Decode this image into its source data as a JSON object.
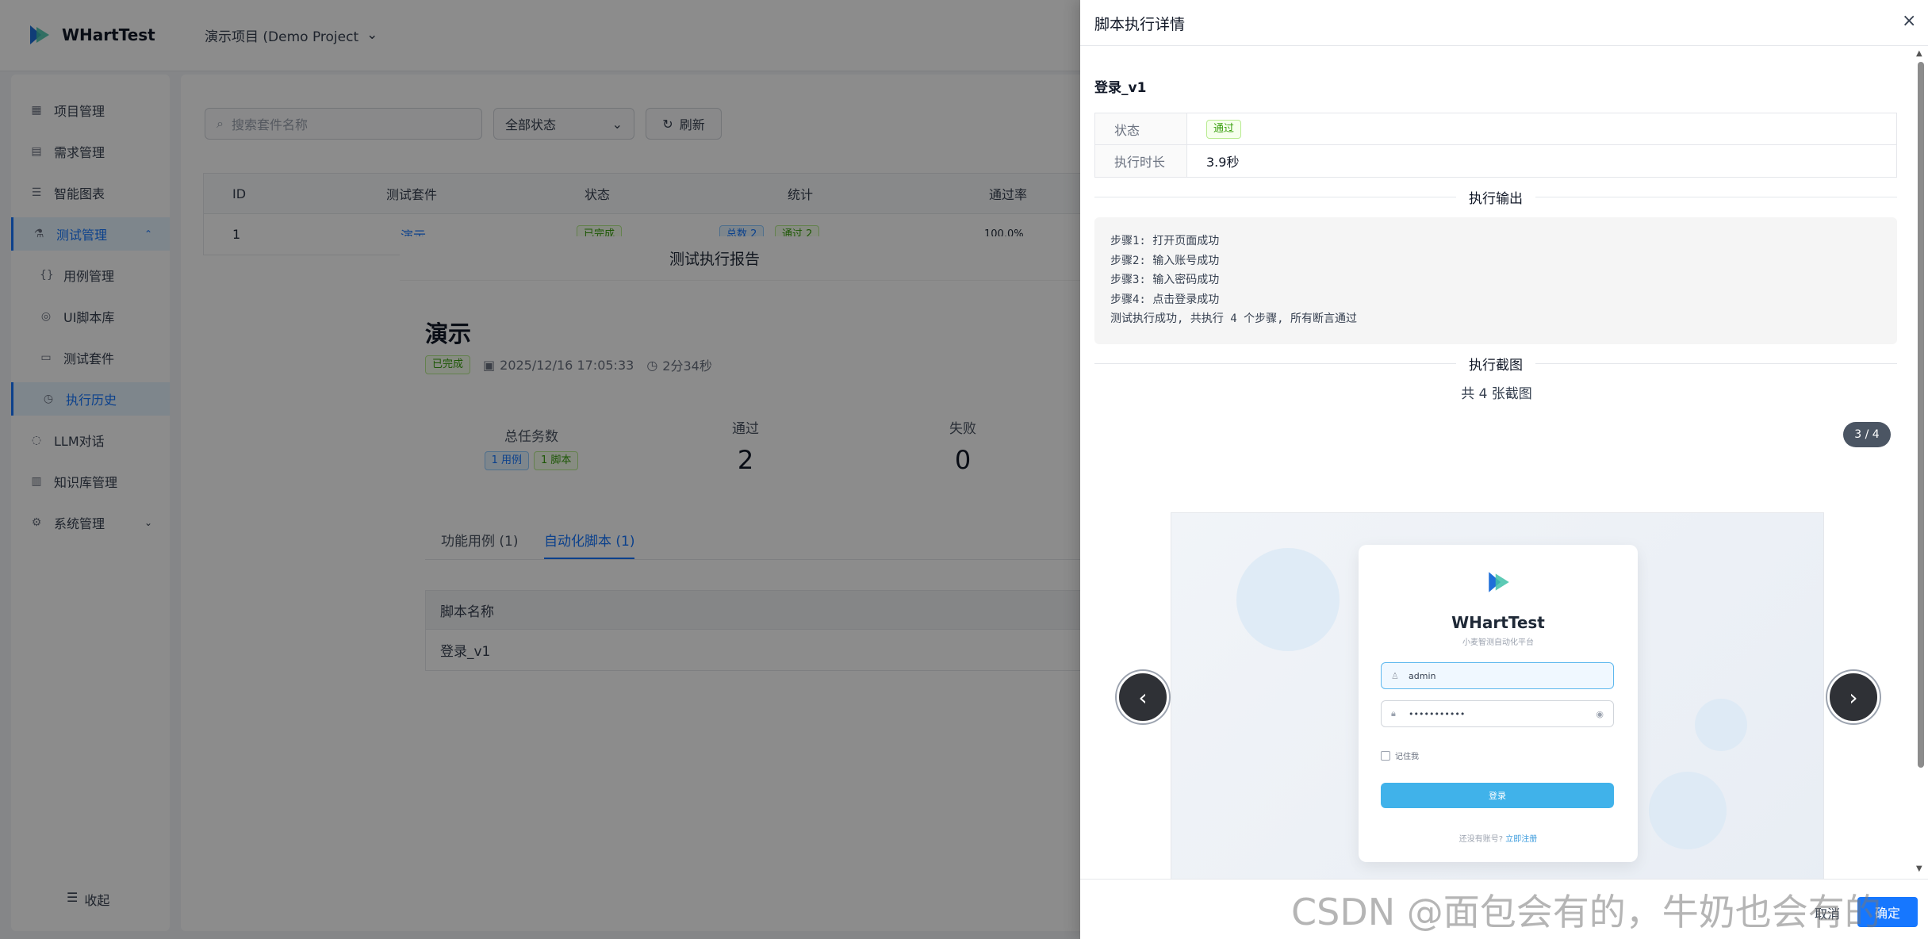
{
  "app": {
    "name": "WHartTest",
    "project": "演示项目 (Demo Project"
  },
  "sidebar": {
    "items": [
      {
        "label": "项目管理",
        "icon": "grid-icon"
      },
      {
        "label": "需求管理",
        "icon": "document-icon"
      },
      {
        "label": "智能图表",
        "icon": "list-icon"
      },
      {
        "label": "测试管理",
        "icon": "test-icon"
      },
      {
        "label": "用例管理",
        "icon": "braces-icon"
      },
      {
        "label": "UI脚本库",
        "icon": "cube-icon"
      },
      {
        "label": "测试套件",
        "icon": "folder-icon"
      },
      {
        "label": "执行历史",
        "icon": "clock-icon"
      },
      {
        "label": "LLM对话",
        "icon": "chat-icon"
      },
      {
        "label": "知识库管理",
        "icon": "book-icon"
      },
      {
        "label": "系统管理",
        "icon": "gear-icon"
      }
    ],
    "collapse": "收起"
  },
  "filters": {
    "search_placeholder": "搜索套件名称",
    "status": "全部状态",
    "refresh": "刷新"
  },
  "table": {
    "headers": [
      "ID",
      "测试套件",
      "状态",
      "统计",
      "通过率"
    ],
    "row": {
      "id": "1",
      "suite": "演示",
      "status": "已完成",
      "stat_total": "总数 2",
      "stat_pass": "通过 2",
      "rate": "100.0%"
    }
  },
  "report_modal": {
    "title": "测试执行报告",
    "name": "演示",
    "status": "已完成",
    "datetime": "2025/12/16 17:05:33",
    "duration": "2分34秒",
    "stats": {
      "total_label": "总任务数",
      "total_case_tag": "1 用例",
      "total_script_tag": "1 脚本",
      "pass_label": "通过",
      "pass_value": "2",
      "fail_label": "失败",
      "fail_value": "0"
    },
    "tabs": [
      "功能用例 (1)",
      "自动化脚本 (1)"
    ],
    "script_table": {
      "header": "脚本名称",
      "row": "登录_v1"
    }
  },
  "drawer": {
    "title": "脚本执行详情",
    "close": "×",
    "script_name": "登录_v1",
    "fields": [
      {
        "label": "状态",
        "value": "通过"
      },
      {
        "label": "执行时长",
        "value": "3.9秒"
      }
    ],
    "output_title": "执行输出",
    "output_lines": [
      "步骤1: 打开页面成功",
      "步骤2: 输入账号成功",
      "步骤3: 输入密码成功",
      "步骤4: 点击登录成功",
      "测试执行成功, 共执行 4 个步骤, 所有断言通过"
    ],
    "screenshots_title": "执行截图",
    "screenshots_count": "共 4 张截图",
    "indicator": "3 / 4",
    "screenshot": {
      "app_name": "WHartTest",
      "subtitle": "小麦智测自动化平台",
      "username": "admin",
      "password": "•••••••••••",
      "remember": "记住我",
      "login": "登录",
      "footer_text": "还没有账号?",
      "footer_link": "立即注册"
    },
    "cancel": "取消",
    "ok": "确定"
  },
  "watermark": "CSDN @面包会有的，牛奶也会有的",
  "colors": {
    "primary": "#1677ff",
    "success": "#389e0d",
    "login_button": "#40b2ea"
  }
}
